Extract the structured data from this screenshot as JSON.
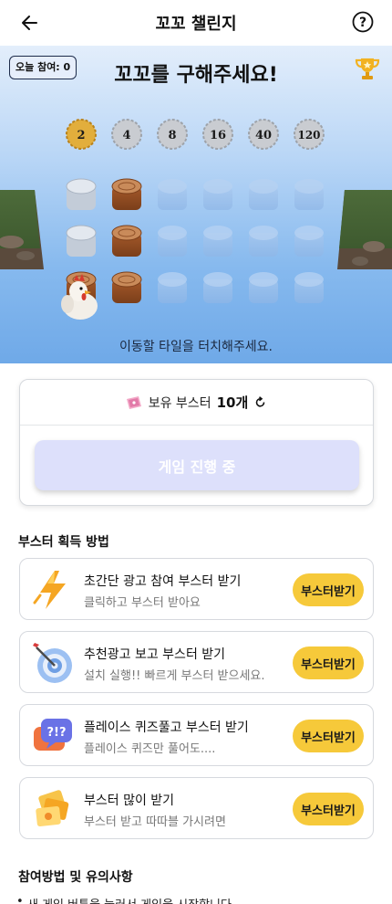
{
  "header": {
    "title": "꼬꼬 챌린지"
  },
  "game": {
    "today_label": "오늘 참여: 0",
    "headline": "꼬꼬를 구해주세요!",
    "hint": "이동할 타일을 터치해주세요.",
    "multipliers": [
      "2",
      "4",
      "8",
      "16",
      "40",
      "120"
    ],
    "active_multiplier_index": 0
  },
  "booster": {
    "label": "보유 부스터",
    "count": "10개",
    "play_button": "게임 진행 중"
  },
  "acquire_title": "부스터 획득 방법",
  "tasks": [
    {
      "title": "초간단 광고 참여 부스터 받기",
      "desc": "클릭하고 부스터 받아요",
      "button": "부스터받기"
    },
    {
      "title": "추천광고 보고 부스터 받기",
      "desc": "설치 실행!! 빠르게 부스터 받으세요.",
      "button": "부스터받기"
    },
    {
      "title": "플레이스 퀴즈풀고 부스터 받기",
      "desc": "플레이스 퀴즈만 풀어도....",
      "button": "부스터받기"
    },
    {
      "title": "부스터 많이 받기",
      "desc": "부스터 받고 따따블 가시려면",
      "button": "부스터받기"
    }
  ],
  "notes_title": "참여방법 및 유의사항",
  "notes": [
    "새 게임 버튼을 눌러서 게임을 시작합니다."
  ],
  "colors": {
    "accent_button": "#f6c93a",
    "active_coin": "#e2ae3c",
    "inactive_coin": "#c9ccd1",
    "disabled_button": "#dde0fb"
  }
}
